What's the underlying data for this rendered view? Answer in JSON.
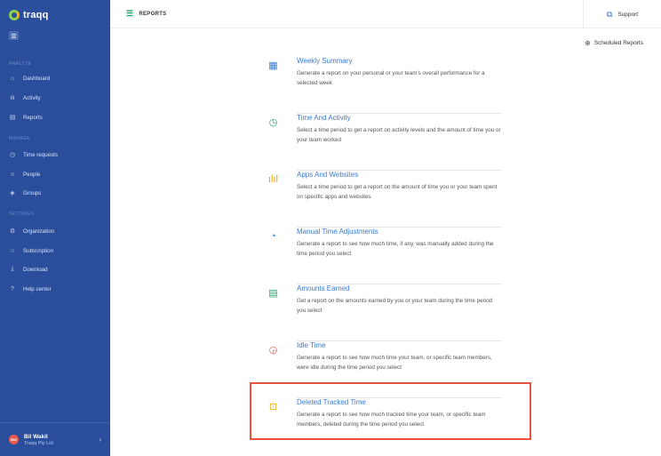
{
  "app": {
    "logo_text": "traqq"
  },
  "sidebar": {
    "sections": [
      {
        "label": "ANALYZE"
      },
      {
        "label": "MANAGE"
      },
      {
        "label": "SETTINGS"
      }
    ],
    "items": [
      {
        "label": "Dashboard",
        "icon": "home-icon"
      },
      {
        "label": "Activity",
        "icon": "bar-chart-icon"
      },
      {
        "label": "Reports",
        "icon": "reports-icon"
      },
      {
        "label": "Time requests",
        "icon": "clock-icon"
      },
      {
        "label": "People",
        "icon": "people-icon"
      },
      {
        "label": "Groups",
        "icon": "groups-icon"
      },
      {
        "label": "Organization",
        "icon": "gear-icon"
      },
      {
        "label": "Subscription",
        "icon": "star-icon"
      },
      {
        "label": "Download",
        "icon": "download-icon"
      },
      {
        "label": "Help center",
        "icon": "help-icon"
      }
    ],
    "user": {
      "initials": "BW",
      "name": "Bil Wakil",
      "org": "Traqq Pty Ltd"
    }
  },
  "header": {
    "title": "REPORTS",
    "support_label": "Support"
  },
  "scheduled_label": "Scheduled Reports",
  "reports": [
    {
      "title": "Weekly Summary",
      "desc": "Generate a report on your personal or your team's overall performance for a selected week",
      "icon": "calendar-icon",
      "color": "#3a7bd5"
    },
    {
      "title": "Time And Activity",
      "desc": "Select a time period to get a report on activity levels and the amount of time you or your team worked",
      "icon": "clock-icon",
      "color": "#22a36b"
    },
    {
      "title": "Apps And Websites",
      "desc": "Select a time period to get a report on the amount of time you or your team spent on specific apps and websites",
      "icon": "bar-chart-icon",
      "color": "#f0a500"
    },
    {
      "title": "Manual Time Adjustments",
      "desc": "Generate a report to see how much time, if any, was manually added during the time period you select",
      "icon": "pie-chart-icon",
      "color": "#3a7bd5"
    },
    {
      "title": "Amounts Earned",
      "desc": "Get a report on the amounts earned by you or your team during the time period you select",
      "icon": "money-doc-icon",
      "color": "#22a36b"
    },
    {
      "title": "Idle Time",
      "desc": "Generate a report to see how much time your team, or specific team members, were idle during the time period you select",
      "icon": "idle-clock-icon",
      "color": "#e8533f"
    },
    {
      "title": "Deleted Tracked Time",
      "desc": "Generate a report to see how much tracked time your team, or specific team members, deleted during the time period you select",
      "icon": "deleted-time-icon",
      "color": "#f0a500"
    }
  ],
  "colors": {
    "sidebar_bg": "#2a4d9c",
    "accent": "#3a7bd5",
    "highlight": "#e8533f"
  }
}
